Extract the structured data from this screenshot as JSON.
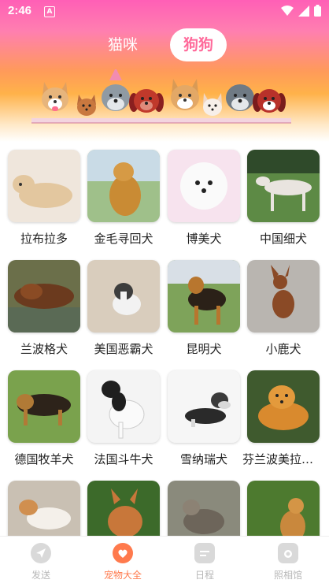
{
  "status_bar": {
    "time": "2:46",
    "notification_letter": "A"
  },
  "tabs": {
    "cat_label": "猫咪",
    "dog_label": "狗狗"
  },
  "grid": {
    "items": [
      {
        "label": "拉布拉多"
      },
      {
        "label": "金毛寻回犬"
      },
      {
        "label": "博美犬"
      },
      {
        "label": "中国细犬"
      },
      {
        "label": "兰波格犬"
      },
      {
        "label": "美国恶霸犬"
      },
      {
        "label": "昆明犬"
      },
      {
        "label": "小鹿犬"
      },
      {
        "label": "德国牧羊犬"
      },
      {
        "label": "法国斗牛犬"
      },
      {
        "label": "雪纳瑞犬"
      },
      {
        "label": "芬兰波美拉尼亚犬"
      },
      {
        "label": ""
      },
      {
        "label": ""
      },
      {
        "label": ""
      },
      {
        "label": ""
      }
    ]
  },
  "bottom_nav": {
    "items": [
      {
        "label": "发送",
        "icon": "send-icon"
      },
      {
        "label": "宠物大全",
        "icon": "pet-encyclopedia-icon"
      },
      {
        "label": "日程",
        "icon": "calendar-icon"
      },
      {
        "label": "照相馆",
        "icon": "camera-icon"
      }
    ],
    "active_color": "#ff7a4d",
    "inactive_color": "#b7b7b7"
  },
  "colors": {
    "header_pink": "#ff5fb6",
    "header_orange": "#ff9a5a",
    "tab_active_text": "#ff6a9a"
  }
}
